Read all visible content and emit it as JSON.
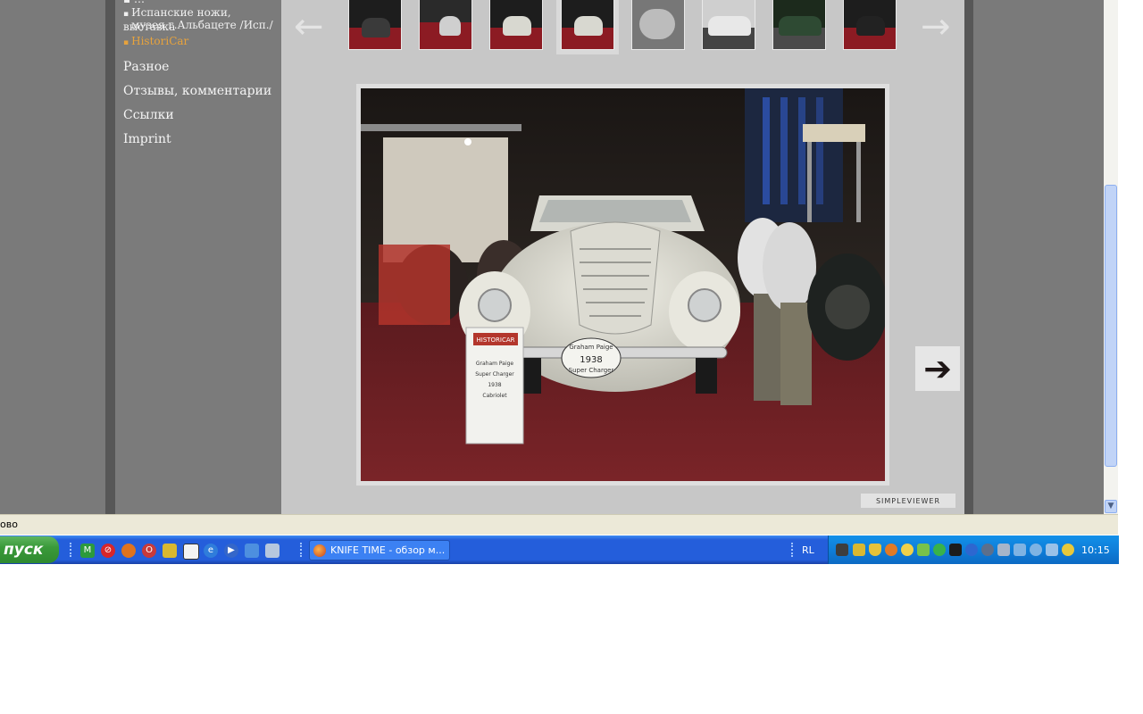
{
  "sidebar": {
    "sub_items": [
      "Испанские ножи, выставка",
      "музея г.Альбацете /Исп./",
      "HistoriCar"
    ],
    "nav_items": [
      "Разное",
      "Отзывы, комментарии",
      "Ссылки",
      "Imprint"
    ]
  },
  "gallery": {
    "prev_icon": "←",
    "next_icon": "→",
    "next_photo_icon": "➔",
    "badge": "SIMPLEVIEWER"
  },
  "photo": {
    "sign_title": "HISTORICAR",
    "sign_lines": [
      "Graham Paige",
      "Super Charger",
      "1938",
      "Cabriolet"
    ],
    "plate_top": "Graham Paige",
    "plate_year": "1938",
    "plate_bottom": "Super Charger"
  },
  "status_bar": {
    "text": "ово"
  },
  "taskbar": {
    "start_label": "пуск",
    "window_title": "KNIFE TIME - обзор м...",
    "lang": "RL",
    "clock": "10:15"
  },
  "colors": {
    "active_link": "#e8a33c",
    "taskbar": "#245edb",
    "start": "#3a9a3a"
  }
}
